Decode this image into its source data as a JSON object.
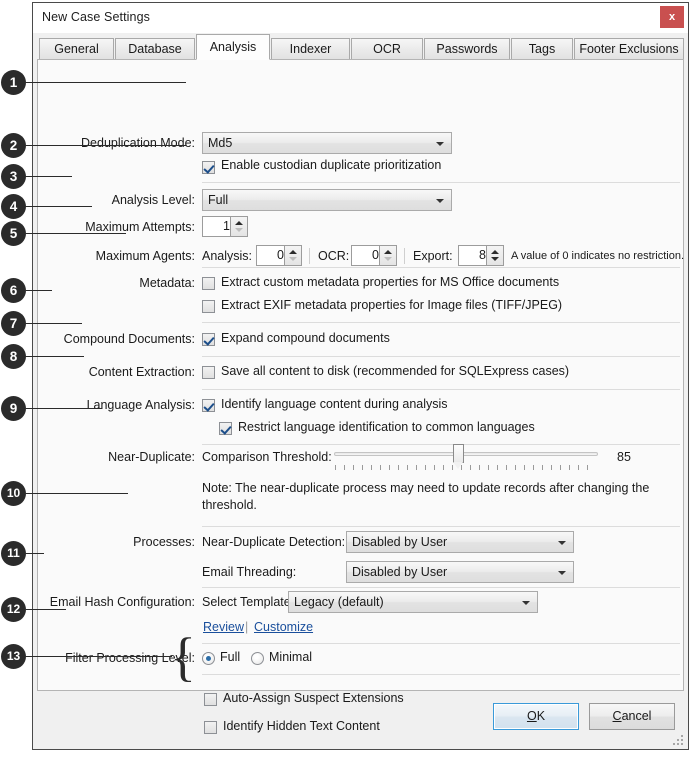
{
  "window": {
    "title": "New Case Settings",
    "close_label": "x"
  },
  "tabs": [
    {
      "label": "General",
      "active": false
    },
    {
      "label": "Database",
      "active": false
    },
    {
      "label": "Analysis",
      "active": true
    },
    {
      "label": "Indexer",
      "active": false
    },
    {
      "label": "OCR",
      "active": false
    },
    {
      "label": "Passwords",
      "active": false
    },
    {
      "label": "Tags",
      "active": false
    },
    {
      "label": "Footer Exclusions",
      "active": false
    }
  ],
  "callouts": [
    "1",
    "2",
    "3",
    "4",
    "5",
    "6",
    "7",
    "8",
    "9",
    "10",
    "11",
    "12",
    "13"
  ],
  "rows": {
    "dedup": {
      "label": "Deduplication Mode:",
      "combo_value": "Md5",
      "checkbox_label": "Enable custodian duplicate prioritization",
      "checkbox_checked": true
    },
    "analysis_level": {
      "label": "Analysis Level:",
      "combo_value": "Full"
    },
    "max_attempts": {
      "label": "Maximum Attempts:",
      "value": "1"
    },
    "max_agents": {
      "label": "Maximum Agents:",
      "analysis_label": "Analysis:",
      "analysis_value": "0",
      "ocr_label": "OCR:",
      "ocr_value": "0",
      "export_label": "Export:",
      "export_value": "8",
      "hint": "A value of 0 indicates no restriction."
    },
    "metadata": {
      "label": "Metadata:",
      "opt1_label": "Extract custom metadata properties for MS Office documents",
      "opt1_checked": false,
      "opt2_label": "Extract EXIF metadata properties for Image files (TIFF/JPEG)",
      "opt2_checked": false
    },
    "compound": {
      "label": "Compound Documents:",
      "checkbox_label": "Expand compound documents",
      "checkbox_checked": true
    },
    "content_extraction": {
      "label": "Content Extraction:",
      "checkbox_label": "Save all content to disk (recommended for SQLExpress cases)",
      "checkbox_checked": false
    },
    "language": {
      "label": "Language Analysis:",
      "opt1_label": "Identify language content during analysis",
      "opt1_checked": true,
      "opt2_label": "Restrict language identification to common languages",
      "opt2_checked": true
    },
    "near_duplicate": {
      "label": "Near-Duplicate:",
      "threshold_label": "Comparison Threshold:",
      "threshold_value": "85",
      "note": "Note: The near-duplicate process may need to update records after changing the threshold."
    },
    "processes": {
      "label": "Processes:",
      "nd_label": "Near-Duplicate Detection:",
      "nd_value": "Disabled by User",
      "et_label": "Email Threading:",
      "et_value": "Disabled by User"
    },
    "email_hash": {
      "label": "Email Hash Configuration:",
      "select_label": "Select Template:",
      "select_value": "Legacy (default)",
      "review_link": "Review",
      "link_separator": "|",
      "customize_link": "Customize"
    },
    "filter_level": {
      "label": "Filter Processing Level:",
      "opt_full": "Full",
      "opt_minimal": "Minimal",
      "selected": "Full"
    },
    "extras": {
      "opt1_label": "Auto-Assign Suspect Extensions",
      "opt1_checked": false,
      "opt2_label": "Identify Hidden Text Content",
      "opt2_checked": false
    }
  },
  "footer": {
    "ok_label": "OK",
    "cancel_label": "Cancel"
  },
  "colors": {
    "close_red": "#c9504f",
    "link_blue": "#1a4f9c",
    "badge_dark": "#2b2b2b",
    "focus_blue": "#3a9ad9"
  }
}
